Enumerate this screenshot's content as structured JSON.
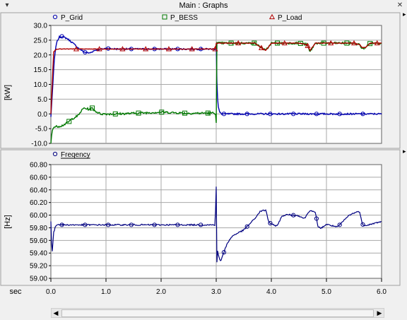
{
  "window": {
    "title": "Main : Graphs"
  },
  "colors": {
    "grid": "#0000b0",
    "bess": "#007800",
    "load": "#b00000",
    "freq": "#000080",
    "plot_bg": "#ffffff",
    "grid_lines": "#a8a8a8"
  },
  "chart_data": [
    {
      "type": "line",
      "ylabel": "[kW]",
      "ylim": [
        -10.0,
        30.0
      ],
      "yticks": [
        "30.0",
        "25.0",
        "20.0",
        "15.0",
        "10.0",
        "5.0",
        "0.0",
        "-5.0",
        "-10.0"
      ],
      "xlim": [
        0.0,
        6.0
      ],
      "grid": true,
      "legend_placement": "top",
      "series": [
        {
          "name": "P_Grid",
          "marker": "circle",
          "color_key": "grid",
          "x": [
            0.0,
            0.03,
            0.06,
            0.1,
            0.15,
            0.2,
            0.3,
            0.4,
            0.5,
            0.6,
            0.7,
            0.8,
            1.0,
            1.2,
            1.5,
            2.0,
            2.5,
            2.99,
            3.0,
            3.01,
            3.03,
            3.06,
            3.1,
            3.2,
            4.0,
            5.0,
            6.0
          ],
          "y": [
            -1.0,
            8.0,
            18.0,
            24.0,
            26.0,
            26.3,
            25.5,
            24.0,
            22.3,
            21.0,
            20.6,
            21.6,
            22.2,
            22.0,
            22.0,
            22.0,
            22.0,
            22.0,
            23.5,
            12.0,
            3.0,
            0.6,
            0.0,
            0.0,
            0.0,
            0.0,
            0.0
          ]
        },
        {
          "name": "P_BESS",
          "marker": "square",
          "color_key": "bess",
          "x": [
            0.0,
            0.02,
            0.05,
            0.1,
            0.2,
            0.3,
            0.4,
            0.5,
            0.55,
            0.6,
            0.7,
            0.75,
            0.8,
            0.9,
            1.0,
            1.2,
            1.5,
            2.0,
            2.5,
            2.95,
            2.99,
            3.0,
            3.01,
            3.05,
            3.2,
            3.5,
            3.7,
            3.85,
            3.9,
            4.0,
            4.5,
            4.65,
            4.7,
            4.8,
            5.0,
            5.5,
            5.6,
            5.65,
            5.7,
            5.8,
            6.0
          ],
          "y": [
            -10.0,
            -6.0,
            -4.5,
            -4.3,
            -4.0,
            -3.0,
            -1.5,
            -0.5,
            1.0,
            2.0,
            1.5,
            2.0,
            1.0,
            0.0,
            0.0,
            0.0,
            0.2,
            0.6,
            0.2,
            0.3,
            0.2,
            -3.0,
            24.0,
            24.0,
            24.0,
            24.0,
            24.0,
            22.0,
            21.5,
            24.0,
            24.0,
            23.5,
            21.0,
            24.0,
            24.0,
            24.0,
            23.5,
            22.0,
            22.5,
            24.0,
            24.0
          ]
        },
        {
          "name": "P_Load",
          "marker": "triangle",
          "color_key": "load",
          "x": [
            0.0,
            0.05,
            0.1,
            0.2,
            0.5,
            1.0,
            1.5,
            2.0,
            2.5,
            2.99,
            3.0,
            3.05,
            3.2,
            3.5,
            3.7,
            3.85,
            3.9,
            4.0,
            4.5,
            4.65,
            4.7,
            4.8,
            5.0,
            5.5,
            5.6,
            5.65,
            5.7,
            5.8,
            6.0
          ],
          "y": [
            0.0,
            21.0,
            22.0,
            22.0,
            22.0,
            22.0,
            22.0,
            22.0,
            22.0,
            22.0,
            24.0,
            24.0,
            24.0,
            24.0,
            24.0,
            22.0,
            21.5,
            24.0,
            24.0,
            23.5,
            21.5,
            24.0,
            24.0,
            24.0,
            23.5,
            22.5,
            22.5,
            24.0,
            24.0
          ]
        }
      ]
    },
    {
      "type": "line",
      "ylabel": "[Hz]",
      "ylim": [
        59.0,
        61.0
      ],
      "yticks": [
        "60.80",
        "60.60",
        "60.40",
        "60.20",
        "60.00",
        "59.80",
        "59.60",
        "59.40",
        "59.20",
        "59.00"
      ],
      "xlim": [
        0.0,
        6.0
      ],
      "xlabel": "sec",
      "xticks": [
        "0.0",
        "1.0",
        "2.0",
        "3.0",
        "4.0",
        "5.0",
        "6.0"
      ],
      "grid": true,
      "series": [
        {
          "name": "Freqency",
          "marker": "circle",
          "color_key": "freq",
          "x": [
            0.0,
            0.02,
            0.05,
            0.08,
            0.1,
            0.15,
            0.2,
            0.5,
            1.0,
            1.5,
            2.0,
            2.5,
            2.98,
            3.0,
            3.01,
            3.02,
            3.04,
            3.08,
            3.1,
            3.2,
            3.3,
            3.5,
            3.7,
            3.8,
            3.9,
            3.95,
            4.0,
            4.1,
            4.2,
            4.3,
            4.5,
            4.6,
            4.7,
            4.8,
            4.85,
            4.9,
            5.0,
            5.2,
            5.4,
            5.5,
            5.6,
            5.65,
            5.7,
            5.8,
            6.0
          ],
          "y": [
            60.0,
            59.4,
            59.8,
            59.9,
            59.94,
            59.95,
            59.94,
            59.94,
            59.94,
            59.94,
            59.94,
            59.94,
            59.94,
            60.62,
            59.2,
            59.5,
            59.4,
            59.3,
            59.35,
            59.62,
            59.75,
            59.85,
            60.05,
            60.18,
            60.2,
            60.0,
            59.95,
            59.92,
            60.1,
            60.12,
            60.1,
            60.05,
            60.2,
            60.15,
            59.9,
            59.88,
            59.95,
            59.9,
            60.1,
            60.15,
            60.18,
            59.95,
            59.93,
            59.95,
            60.0
          ]
        }
      ]
    }
  ]
}
